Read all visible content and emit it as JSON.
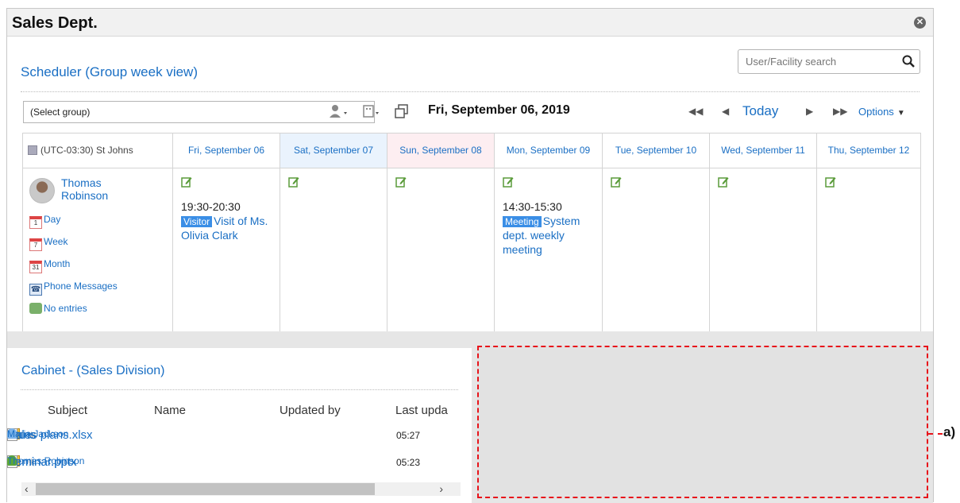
{
  "portlet": {
    "title": "Sales Dept."
  },
  "scheduler": {
    "title": "Scheduler (Group week view)",
    "search_placeholder": "User/Facility search",
    "group_select": "(Select group)",
    "current_date": "Fri, September 06, 2019",
    "today_label": "Today",
    "options_label": "Options",
    "timezone": "(UTC-03:30) St Johns",
    "days": [
      {
        "label": "Fri, September 06"
      },
      {
        "label": "Sat, September 07"
      },
      {
        "label": "Sun, September 08"
      },
      {
        "label": "Mon, September 09"
      },
      {
        "label": "Tue, September 10"
      },
      {
        "label": "Wed, September 11"
      },
      {
        "label": "Thu, September 12"
      }
    ],
    "user": {
      "name": "Thomas Robinson",
      "links": {
        "day": "Day",
        "week": "Week",
        "month": "Month",
        "phone": "Phone Messages",
        "no_entries": "No entries"
      },
      "cal_day": "1",
      "cal_week": "7",
      "cal_month": "31"
    },
    "events": {
      "fri": {
        "time": "19:30-20:30",
        "tag": "Visitor",
        "title": "Visit of Ms. Olivia Clark"
      },
      "mon": {
        "time": "14:30-15:30",
        "tag": "Meeting",
        "title": "System dept. weekly meeting"
      }
    }
  },
  "cabinet": {
    "title": "Cabinet - (Sales Division)",
    "columns": {
      "subject": "Subject",
      "name": "Name",
      "updated_by": "Updated by",
      "last_updated": "Last upda"
    },
    "rows": [
      {
        "subject": "plans",
        "name": "Sales plans.xlsx",
        "updated_by": "Maria Jackson",
        "time": "05:27"
      },
      {
        "subject": "Seminar.pptx",
        "name": "Seminar.pptx",
        "updated_by": "Thomas Robinson",
        "time": "05:23"
      }
    ]
  },
  "annotation": {
    "label": "a)"
  },
  "colors": {
    "link": "#1a6fc4",
    "tag": "#3a8ee6",
    "annotation": "#e8131a",
    "saturday": "#eaf3fd",
    "sunday": "#fdeef1"
  }
}
